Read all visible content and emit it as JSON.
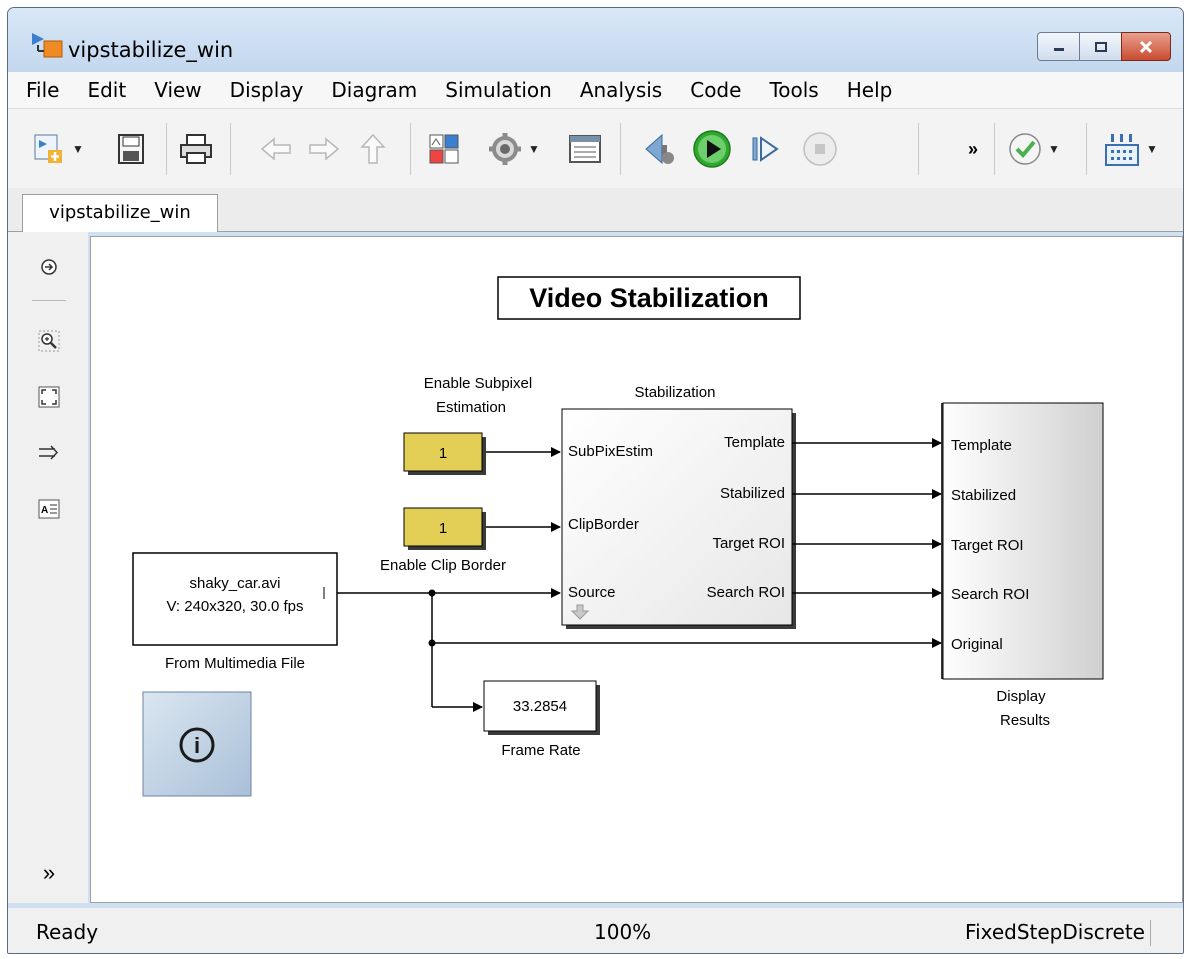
{
  "window": {
    "title": "vipstabilize_win"
  },
  "menu": [
    "File",
    "Edit",
    "View",
    "Display",
    "Diagram",
    "Simulation",
    "Analysis",
    "Code",
    "Tools",
    "Help"
  ],
  "toolbar": {
    "overflow_label": "»"
  },
  "tab": {
    "label": "vipstabilize_win"
  },
  "diagram": {
    "title": "Video Stabilization",
    "blocks": {
      "subpixel_const": {
        "value": "1",
        "label_line1": "Enable Subpixel",
        "label_line2": "Estimation"
      },
      "clip_const": {
        "value": "1",
        "label": "Enable Clip Border"
      },
      "source": {
        "line1": "shaky_car.avi",
        "line2": "V: 240x320, 30.0 fps",
        "label": "From Multimedia File"
      },
      "stabilization": {
        "label": "Stabilization",
        "inputs": [
          "SubPixEstim",
          "ClipBorder",
          "Source"
        ],
        "outputs": [
          "Template",
          "Stabilized",
          "Target ROI",
          "Search ROI"
        ]
      },
      "display": {
        "label_line1": "Display",
        "label_line2": "Results",
        "inputs": [
          "Template",
          "Stabilized",
          "Target ROI",
          "Search ROI",
          "Original"
        ]
      },
      "frame_rate": {
        "value": "33.2854",
        "label": "Frame Rate"
      },
      "info": {
        "symbol": "i"
      }
    },
    "colors": {
      "constant_fill": "#e3cf56",
      "info_fill": "#b8cde2",
      "run_green": "#2fa82f"
    }
  },
  "status": {
    "state": "Ready",
    "zoom": "100%",
    "solver": "FixedStepDiscrete"
  }
}
